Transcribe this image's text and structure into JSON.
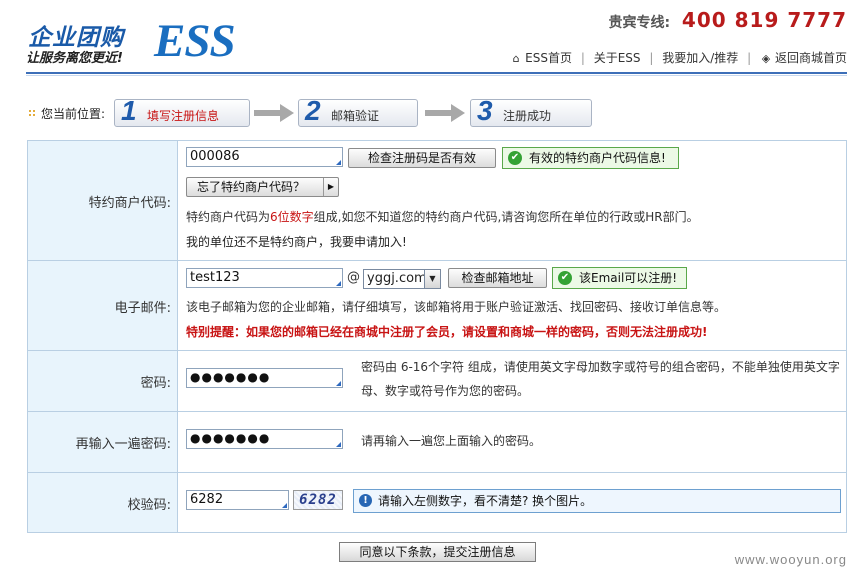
{
  "header": {
    "logo_cn": "企业团购",
    "logo_sub": "让服务离您更近!",
    "logo_ess": "ESS",
    "hotline_label": "贵宾专线:",
    "hotline_number": "400 819 7777",
    "nav": [
      {
        "label": "ESS首页",
        "icon": "home-icon"
      },
      {
        "label": "关于ESS"
      },
      {
        "label": "我要加入/推荐"
      },
      {
        "label": "返回商城首页",
        "icon": "return-icon"
      }
    ]
  },
  "breadcrumb": {
    "label": "您当前位置:",
    "steps": [
      {
        "num": "1",
        "label": "填写注册信息",
        "active": true
      },
      {
        "num": "2",
        "label": "邮箱验证",
        "active": false
      },
      {
        "num": "3",
        "label": "注册成功",
        "active": false
      }
    ]
  },
  "form": {
    "merchant": {
      "label": "特约商户代码:",
      "value": "000086",
      "check_button": "检查注册码是否有效",
      "status": "有效的特约商户代码信息!",
      "forgot_button": "忘了特约商户代码？",
      "help_pre": "特约商户代码为",
      "help_highlight": "6位数字",
      "help_post": "组成,如您不知道您的特约商户代码,请咨询您所在单位的行政或HR部门。",
      "apply_text": "我的单位还不是特约商户，我要申请加入!"
    },
    "email": {
      "label": "电子邮件:",
      "value": "test123",
      "at": "@",
      "domain": "yggj.com",
      "check_button": "检查邮箱地址",
      "status": "该Email可以注册!",
      "help": "该电子邮箱为您的企业邮箱，请仔细填写，该邮箱将用于账户验证激活、找回密码、接收订单信息等。",
      "warning": "特别提醒：如果您的邮箱已经在商城中注册了会员，请设置和商城一样的密码，否则无法注册成功!"
    },
    "password": {
      "label": "密码:",
      "value": "●●●●●●●",
      "help_line1": "密码由 6-16个字符 组成，请使用英文字母加数字或符号的组合密码，不能单独使用英文字",
      "help_line2": "母、数字或符号作为您的密码。"
    },
    "password_confirm": {
      "label": "再输入一遍密码:",
      "value": "●●●●●●●",
      "help": "请再输入一遍您上面输入的密码。"
    },
    "captcha": {
      "label": "校验码:",
      "value": "6282",
      "image_text": "6282",
      "hint": "请输入左侧数字，看不清楚? 换个图片。"
    }
  },
  "submit_label": "同意以下条款，提交注册信息",
  "watermark": "www.wooyun.org"
}
